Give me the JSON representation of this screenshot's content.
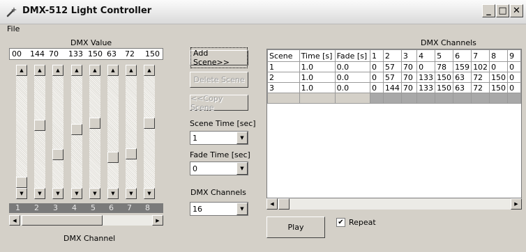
{
  "window": {
    "title": "DMX-512 Light Controller",
    "minimize": "_",
    "maximize": "□",
    "close": "✕"
  },
  "menu": {
    "file": "File"
  },
  "dmx_value_label": "DMX Value",
  "dmx_values": [
    "00",
    "144",
    "70",
    "133",
    "150",
    "63",
    "72",
    "150"
  ],
  "sliders": [
    0,
    144,
    70,
    133,
    150,
    63,
    72,
    150
  ],
  "channel_numbers": [
    "1",
    "2",
    "3",
    "4",
    "5",
    "6",
    "7",
    "8"
  ],
  "dmx_channel_label": "DMX Channel",
  "buttons": {
    "add_scene": "Add Scene>>",
    "delete_scene": "Delete Scene",
    "copy_scene": "<<Copy Scene",
    "play": "Play"
  },
  "scene_time": {
    "label": "Scene Time [sec]",
    "value": "1"
  },
  "fade_time": {
    "label": "Fade Time [sec]",
    "value": "0"
  },
  "dmx_channels_select": {
    "label": "DMX Channels",
    "value": "16"
  },
  "grid": {
    "title": "DMX Channels",
    "headers": [
      "Scene",
      "Time [s]",
      "Fade [s]",
      "1",
      "2",
      "3",
      "4",
      "5",
      "6",
      "7",
      "8",
      "9"
    ],
    "rows": [
      [
        "1",
        "1.0",
        "0.0",
        "0",
        "57",
        "70",
        "0",
        "78",
        "159",
        "102",
        "0",
        "0"
      ],
      [
        "2",
        "1.0",
        "0.0",
        "0",
        "57",
        "70",
        "133",
        "150",
        "63",
        "72",
        "150",
        "0"
      ],
      [
        "3",
        "1.0",
        "0.0",
        "0",
        "144",
        "70",
        "133",
        "150",
        "63",
        "72",
        "150",
        "0"
      ]
    ]
  },
  "repeat": {
    "label": "Repeat",
    "checked": true
  }
}
